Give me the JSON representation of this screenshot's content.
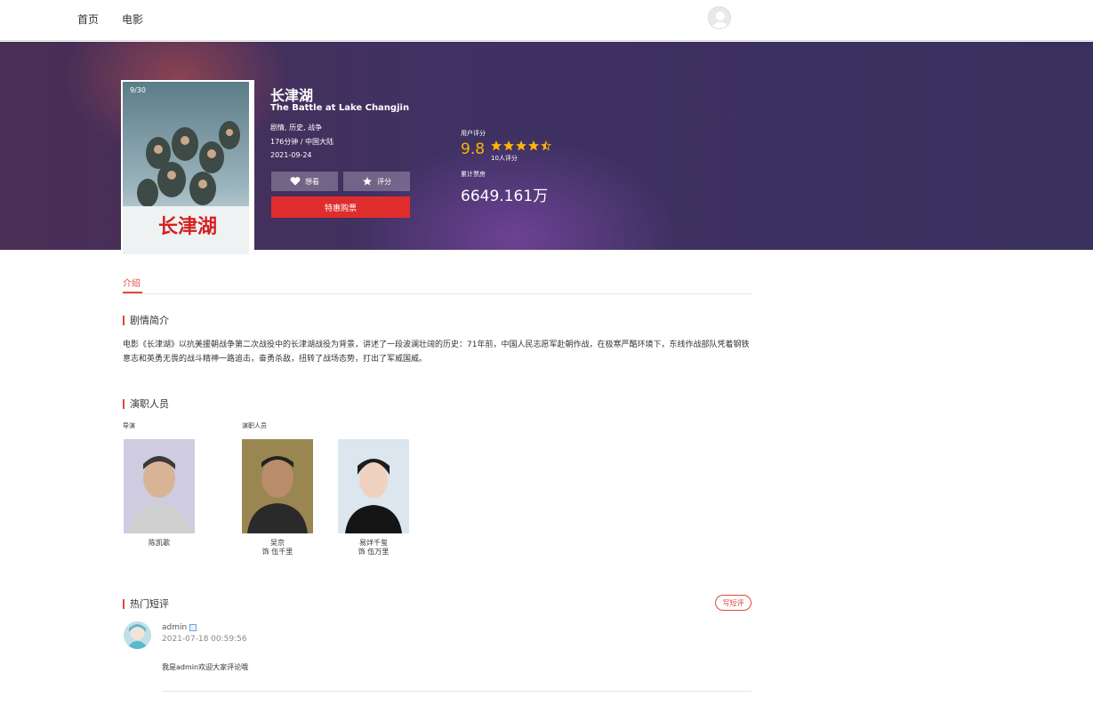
{
  "nav": {
    "home": "首页",
    "movies": "电影"
  },
  "movie": {
    "title": "长津湖",
    "en_title": "The Battle at Lake Changjin",
    "genres": "剧情, 历史, 战争",
    "duration_region": "176分钟 / 中国大陆",
    "release_date": "2021-09-24",
    "poster_title": "长津湖",
    "poster_badge": "9/30"
  },
  "actions": {
    "want": "想看",
    "rate": "评分",
    "buy": "特惠购票"
  },
  "rating": {
    "label": "用户评分",
    "score": "9.8",
    "count": "10人评分",
    "stars": 4.5
  },
  "boxoffice": {
    "label": "累计票房",
    "value": "6649.161万"
  },
  "tabs": {
    "intro": "介绍"
  },
  "plot": {
    "heading": "剧情简介",
    "text": "电影《长津湖》以抗美援朝战争第二次战役中的长津湖战役为背景，讲述了一段波澜壮阔的历史：71年前，中国人民志愿军赴朝作战，在极寒严酷环境下，东线作战部队凭着钢铁意志和英勇无畏的战斗精神一路追击，奋勇杀敌，扭转了战场态势，打出了军威国威。"
  },
  "cast": {
    "heading": "演职人员",
    "director_role": "导演",
    "actor_role": "演职人员",
    "director": {
      "name": "陈凯歌"
    },
    "actors": [
      {
        "name": "吴京",
        "character": "饰 伍千里"
      },
      {
        "name": "易烊千玺",
        "character": "饰 伍万里"
      }
    ]
  },
  "comments": {
    "heading": "热门短评",
    "write": "写短评",
    "items": [
      {
        "user": "admin",
        "time": "2021-07-18 00:59:56",
        "text": "我是admin欢迎大家评论哦"
      }
    ]
  },
  "colors": {
    "accent": "#e0483c",
    "buy": "#df2d2d",
    "score": "#ffb400",
    "hero": "#3f3162"
  }
}
